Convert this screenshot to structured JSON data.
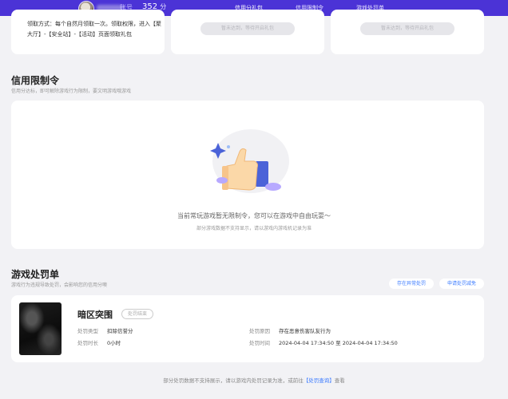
{
  "header": {
    "name_suffix": "账号",
    "score": "352",
    "score_unit": "分",
    "nav": [
      {
        "label": "信用分礼包",
        "active": true
      },
      {
        "label": "信用限制令",
        "active": false
      },
      {
        "label": "游戏处罚单",
        "active": false
      }
    ]
  },
  "top_cards": {
    "claim_text": "领取方式：每个自然月领取一次。领取权限，进入【聚大厅】-【安全站】-【活动】页面领取礼包",
    "claim_button_1": "暂未达到，等待开启礼包",
    "claim_button_2": "暂未达到，等待开启礼包"
  },
  "restriction": {
    "title": "信用限制令",
    "subtitle": "信用分达标，即可解除游戏行为限制，要文明游戏哦游戏",
    "empty_message": "当前常玩游戏暂无限制令，您可以在游戏中自由玩耍～",
    "empty_sub": "部分游戏数据不支持显示，请以游戏内游戏机记录为准"
  },
  "penalty": {
    "title": "游戏处罚单",
    "subtitle": "游戏行为违规导致处罚，会影响您的信用分噢",
    "btn_appeal": "存在异常处罚",
    "btn_lift": "申请处罚减免",
    "game_name": "暗区突围",
    "status": "处罚结束",
    "penalty_type_label": "处罚类型",
    "penalty_type": "扣除信誉分",
    "duration_label": "处罚时长",
    "duration": "0小时",
    "reason_label": "处罚原因",
    "reason": "存在恶意伤害队友行为",
    "time_label": "处罚时间",
    "time_start": "2024-04-04 17:34:50",
    "time_to": "至",
    "time_end": "2024-04-04 17:34:50"
  },
  "footer": {
    "text": "部分处罚数据不支持展示，请以游戏内处罚记录为准，或前往",
    "link": "【处罚查询】",
    "suffix": "查看"
  }
}
